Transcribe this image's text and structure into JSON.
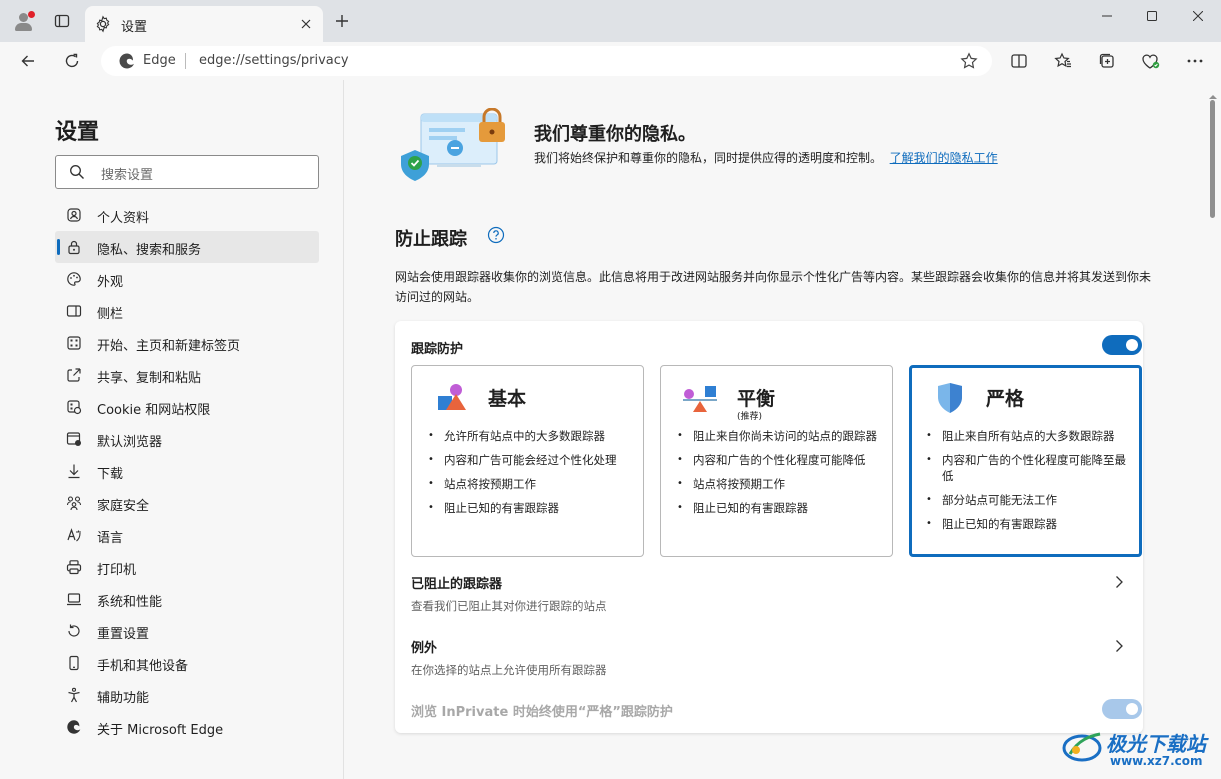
{
  "browser": {
    "tab_title": "设置",
    "site_name": "Edge",
    "url": "edge://settings/privacy"
  },
  "sidebar": {
    "title": "设置",
    "search_placeholder": "搜索设置",
    "items": [
      {
        "label": "个人资料",
        "icon": "profile-icon"
      },
      {
        "label": "隐私、搜索和服务",
        "icon": "lock-icon",
        "active": true
      },
      {
        "label": "外观",
        "icon": "palette-icon"
      },
      {
        "label": "侧栏",
        "icon": "sidebar-icon"
      },
      {
        "label": "开始、主页和新建标签页",
        "icon": "home-grid-icon"
      },
      {
        "label": "共享、复制和粘贴",
        "icon": "share-icon"
      },
      {
        "label": "Cookie 和网站权限",
        "icon": "cookie-icon"
      },
      {
        "label": "默认浏览器",
        "icon": "browser-icon"
      },
      {
        "label": "下载",
        "icon": "download-icon"
      },
      {
        "label": "家庭安全",
        "icon": "family-icon"
      },
      {
        "label": "语言",
        "icon": "language-icon"
      },
      {
        "label": "打印机",
        "icon": "printer-icon"
      },
      {
        "label": "系统和性能",
        "icon": "laptop-icon"
      },
      {
        "label": "重置设置",
        "icon": "reset-icon"
      },
      {
        "label": "手机和其他设备",
        "icon": "phone-icon"
      },
      {
        "label": "辅助功能",
        "icon": "accessibility-icon"
      },
      {
        "label": "关于 Microsoft Edge",
        "icon": "edge-icon"
      }
    ]
  },
  "hero": {
    "title": "我们尊重你的隐私。",
    "description": "我们将始终保护和尊重你的隐私，同时提供应得的透明度和控制。",
    "link": "了解我们的隐私工作"
  },
  "tracking": {
    "title": "防止跟踪",
    "description": "网站会使用跟踪器收集你的浏览信息。此信息将用于改进网站服务并向你显示个性化广告等内容。某些跟踪器会收集你的信息并将其发送到你未访问过的网站。",
    "toggle_label": "跟踪防护",
    "toggle_on": true,
    "options": {
      "basic": {
        "title": "基本",
        "bullets": [
          "允许所有站点中的大多数跟踪器",
          "内容和广告可能会经过个性化处理",
          "站点将按预期工作",
          "阻止已知的有害跟踪器"
        ]
      },
      "balanced": {
        "title": "平衡",
        "subtitle": "(推荐)",
        "bullets": [
          "阻止来自你尚未访问的站点的跟踪器",
          "内容和广告的个性化程度可能降低",
          "站点将按预期工作",
          "阻止已知的有害跟踪器"
        ]
      },
      "strict": {
        "title": "严格",
        "selected": true,
        "bullets": [
          "阻止来自所有站点的大多数跟踪器",
          "内容和广告的个性化程度可能降至最低",
          "部分站点可能无法工作",
          "阻止已知的有害跟踪器"
        ]
      }
    },
    "blocked": {
      "title": "已阻止的跟踪器",
      "subtitle": "查看我们已阻止其对你进行跟踪的站点"
    },
    "exceptions": {
      "title": "例外",
      "subtitle": "在你选择的站点上允许使用所有跟踪器"
    },
    "inprivate": {
      "label": "浏览 InPrivate 时始终使用“严格”跟踪防护",
      "on": true
    }
  },
  "watermark": {
    "text": "极光下载站",
    "url": "www.xz7.com"
  },
  "colors": {
    "accent": "#0f6cbd",
    "background": "#f7f7f7",
    "titlebar": "#dfe2e6"
  }
}
